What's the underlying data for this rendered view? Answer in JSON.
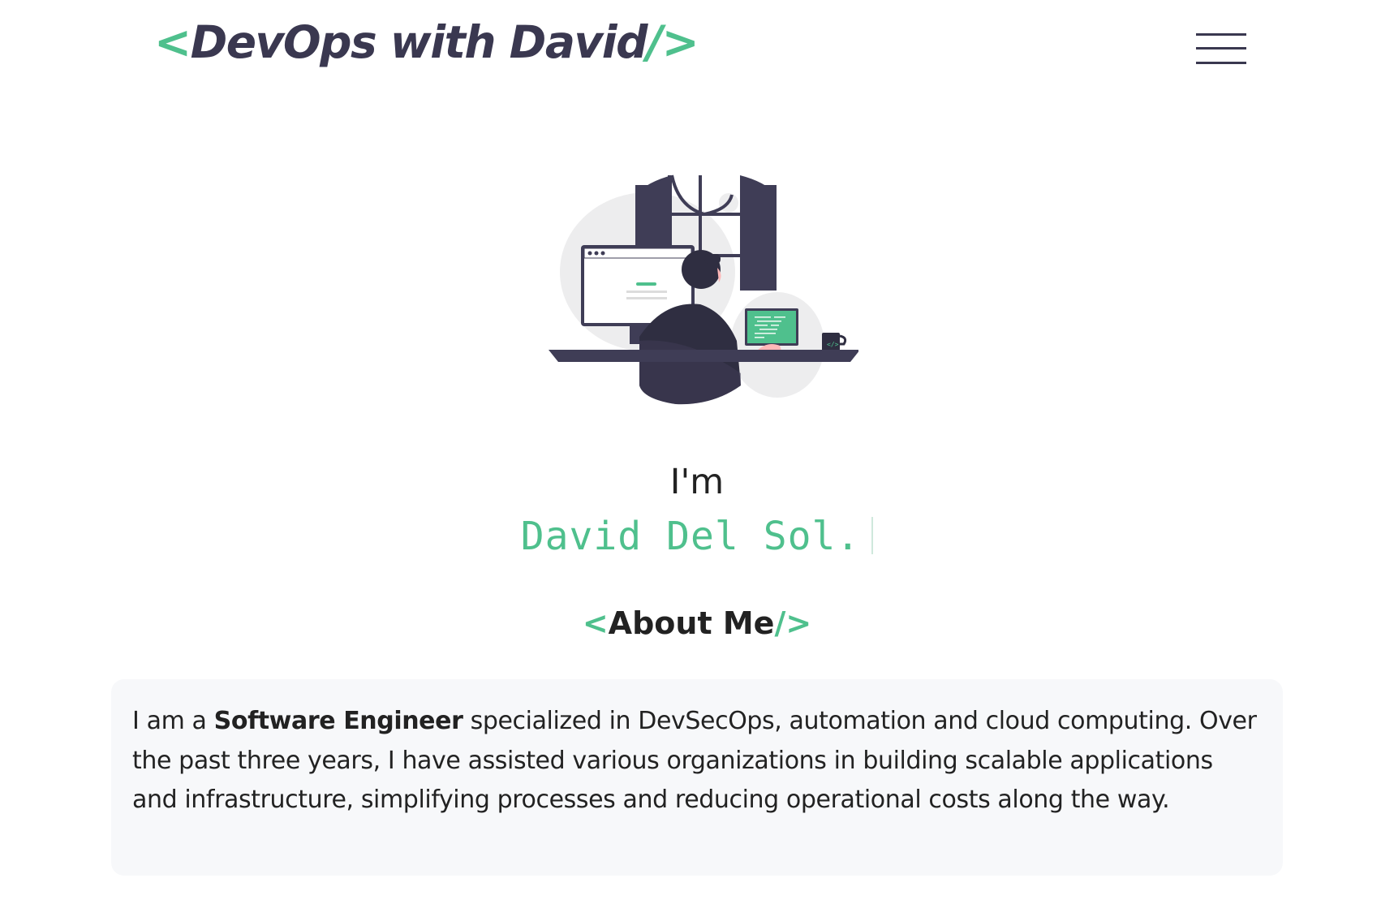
{
  "header": {
    "logo": {
      "open": "<",
      "text": "DevOps with David",
      "close_slash": "/",
      "close": ">"
    },
    "menu_icon": "hamburger-menu-icon"
  },
  "hero": {
    "illustration": "developer-at-desk-illustration",
    "greeting": "I'm",
    "typed_name": "David Del Sol."
  },
  "about": {
    "heading": {
      "open": "<",
      "text": "About Me",
      "close_slash": "/",
      "close": ">"
    },
    "paragraph": {
      "prefix": "I am a ",
      "highlight": "Software Engineer",
      "rest": " specialized in DevSecOps, automation and cloud computing. Over the past three years, I have assisted various organizations in building scalable applications and infrastructure, simplifying processes and reducing operational costs along the way."
    }
  },
  "colors": {
    "accent": "#4fc08d",
    "dark": "#3a3850",
    "card_bg": "#f7f8fa"
  }
}
